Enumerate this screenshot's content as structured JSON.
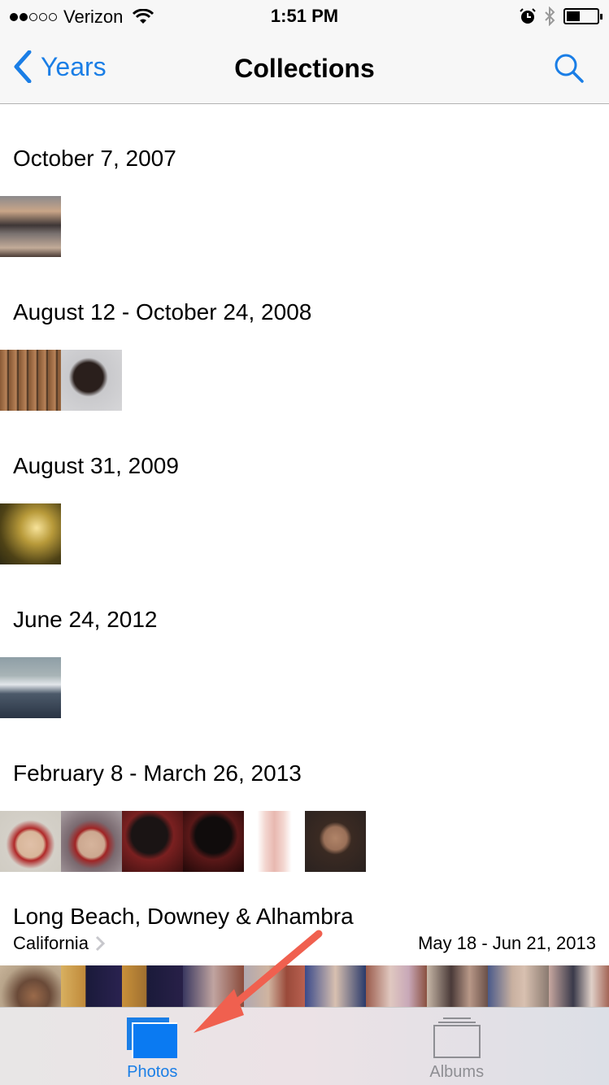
{
  "status_bar": {
    "carrier": "Verizon",
    "signal_bars_filled": 2,
    "signal_bars_total": 5,
    "time": "1:51 PM",
    "battery_level": 0.45,
    "icons": [
      "wifi-icon",
      "alarm-icon",
      "bluetooth-icon",
      "battery-icon"
    ]
  },
  "nav": {
    "back_label": "Years",
    "title": "Collections",
    "search_icon": "search-icon"
  },
  "sections": [
    {
      "title": "October 7, 2007",
      "photo_count": 1
    },
    {
      "title": "August 12 - October 24, 2008",
      "photo_count": 2
    },
    {
      "title": "August 31, 2009",
      "photo_count": 1
    },
    {
      "title": "June 24, 2012",
      "photo_count": 1
    },
    {
      "title": "February 8 - March 26, 2013",
      "photo_count": 6
    },
    {
      "title": "Long Beach, Downey & Alhambra",
      "subtitle": "California",
      "date_range": "May 18 - Jun 21, 2013",
      "photo_count": 10
    }
  ],
  "tabs": [
    {
      "label": "Photos",
      "icon": "photos-stack-icon",
      "active": true
    },
    {
      "label": "Albums",
      "icon": "albums-icon",
      "active": false
    }
  ],
  "colors": {
    "accent": "#1a7ee6",
    "annotation_arrow": "#f0604f",
    "inactive_tab": "#8e8e93"
  }
}
